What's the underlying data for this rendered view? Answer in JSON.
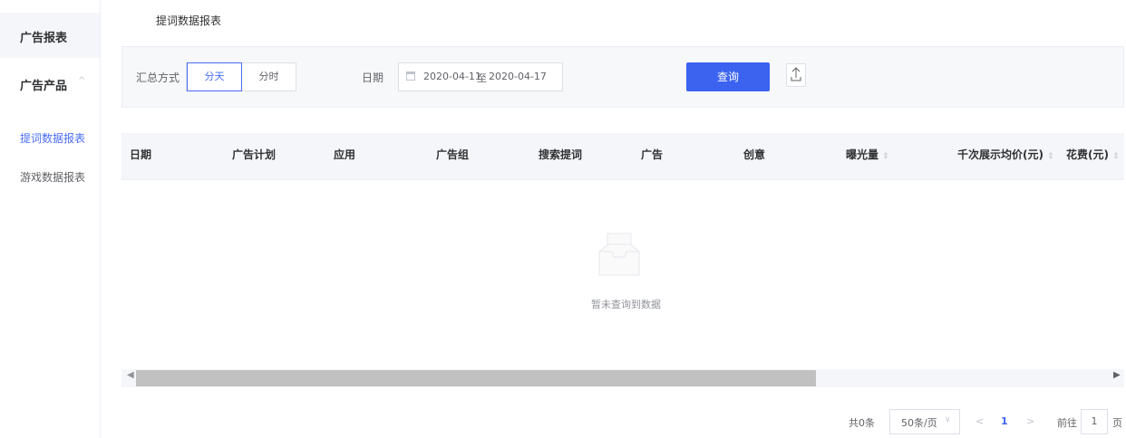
{
  "sidebar": {
    "report_label": "广告报表",
    "product_label": "广告产品",
    "product_chevron": "^",
    "items": [
      {
        "label": "提词数据报表",
        "active": true
      },
      {
        "label": "游戏数据报表",
        "active": false
      }
    ]
  },
  "page": {
    "title": "提词数据报表"
  },
  "filter": {
    "mode_label": "汇总方式",
    "mode_options": [
      "分天",
      "分时"
    ],
    "mode_selected": "分天",
    "date_label": "日期",
    "date_start": "2020-04-11",
    "date_sep": "至",
    "date_end": "2020-04-17",
    "query_label": "查询"
  },
  "table": {
    "columns": [
      {
        "label": "日期",
        "sortable": false
      },
      {
        "label": "广告计划",
        "sortable": false
      },
      {
        "label": "应用",
        "sortable": false
      },
      {
        "label": "广告组",
        "sortable": false
      },
      {
        "label": "搜索提词",
        "sortable": false
      },
      {
        "label": "广告",
        "sortable": false
      },
      {
        "label": "创意",
        "sortable": false
      },
      {
        "label": "曝光量",
        "sortable": true
      },
      {
        "label": "千次展示均价(元)",
        "sortable": true
      },
      {
        "label": "花费(元)",
        "sortable": true
      }
    ],
    "empty_text": "暂未查询到数据",
    "sort_glyph": "⇕"
  },
  "pagination": {
    "total": "共0条",
    "page_size": "50条/页",
    "prev": "<",
    "current": "1",
    "next": ">",
    "goto_label": "前往",
    "goto_value": "1",
    "unit": "页"
  },
  "colors": {
    "accent": "#3b63f0",
    "header_bg": "#f5f6f9"
  }
}
